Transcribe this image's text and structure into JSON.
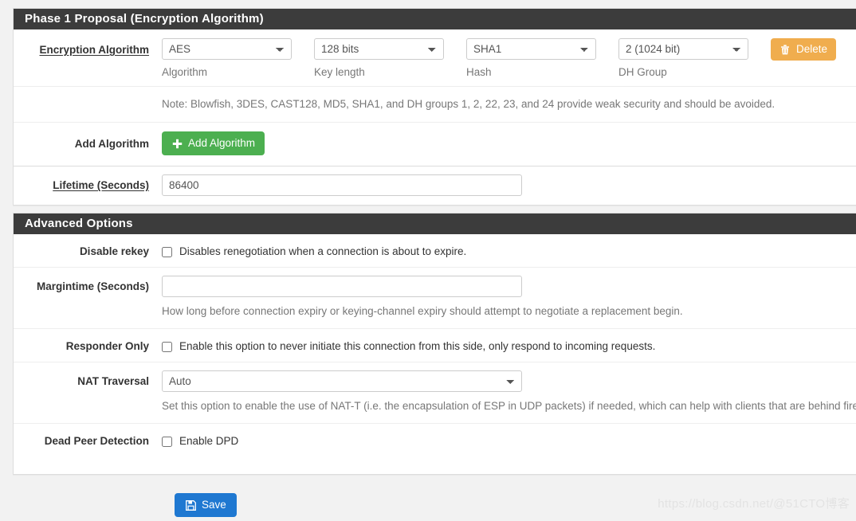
{
  "phase1": {
    "heading": "Phase 1 Proposal (Encryption Algorithm)",
    "rows": {
      "encryption_algorithm": {
        "label": "Encryption Algorithm",
        "fields": [
          {
            "value": "AES",
            "caption": "Algorithm",
            "name": "algorithm-select"
          },
          {
            "value": "128 bits",
            "caption": "Key length",
            "name": "key-length-select"
          },
          {
            "value": "SHA1",
            "caption": "Hash",
            "name": "hash-select"
          },
          {
            "value": "2 (1024 bit)",
            "caption": "DH Group",
            "name": "dh-group-select"
          }
        ],
        "delete_label": "Delete"
      },
      "note": "Note: Blowfish, 3DES, CAST128, MD5, SHA1, and DH groups 1, 2, 22, 23, and 24 provide weak security and should be avoided.",
      "add_algorithm": {
        "label": "Add Algorithm",
        "button_label": "Add Algorithm"
      }
    }
  },
  "lifetime": {
    "label": "Lifetime (Seconds)",
    "value": "86400",
    "placeholder": ""
  },
  "advanced": {
    "heading": "Advanced Options",
    "disable_rekey": {
      "label": "Disable rekey",
      "checkbox_label": "Disables renegotiation when a connection is about to expire.",
      "checked": false
    },
    "margintime": {
      "label": "Margintime (Seconds)",
      "value": "",
      "placeholder": "",
      "help": "How long before connection expiry or keying-channel expiry should attempt to negotiate a replacement begin."
    },
    "responder_only": {
      "label": "Responder Only",
      "checkbox_label": "Enable this option to never initiate this connection from this side, only respond to incoming requests.",
      "checked": false
    },
    "nat_traversal": {
      "label": "NAT Traversal",
      "value": "Auto",
      "help": "Set this option to enable the use of NAT-T (i.e. the encapsulation of ESP in UDP packets) if needed, which can help with clients that are behind firewalls."
    },
    "dead_peer_detection": {
      "label": "Dead Peer Detection",
      "checkbox_label": "Enable DPD",
      "checked": false
    }
  },
  "footer": {
    "save_label": "Save"
  },
  "watermark": {
    "text": "https://blog.csdn.net/@51CTO博客"
  },
  "colors": {
    "panel_heading_bg": "#3c3c3c",
    "delete_btn": "#f0ad4e",
    "add_btn": "#4caf50",
    "save_btn": "#1f78d1",
    "page_bg": "#f2f2f2"
  }
}
